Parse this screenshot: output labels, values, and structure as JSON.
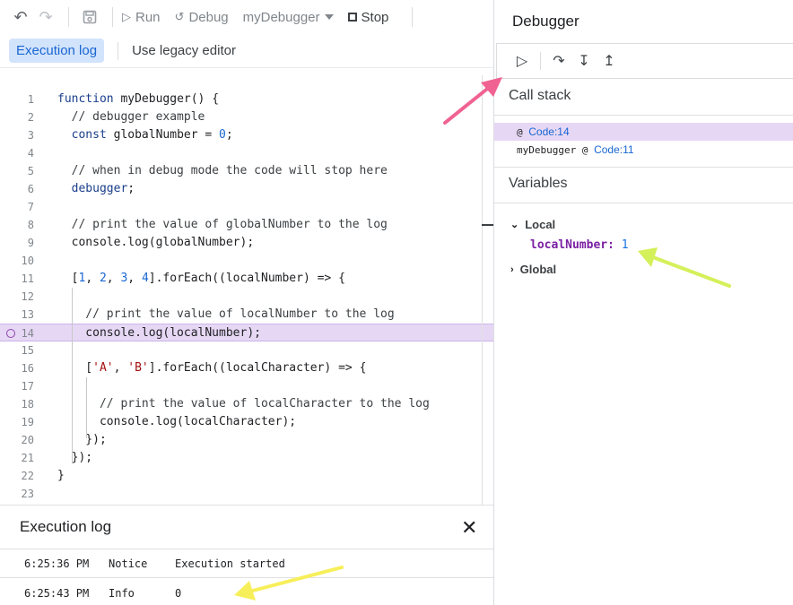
{
  "toolbar": {
    "undo_icon": "undo-icon",
    "redo_icon": "redo-icon",
    "save_icon": "save-icon",
    "run_label": "Run",
    "debug_label": "Debug",
    "function_select": "myDebugger",
    "stop_label": "Stop"
  },
  "subbar": {
    "execution_log": "Execution log",
    "legacy_editor": "Use legacy editor"
  },
  "editor": {
    "current_line": 14,
    "lines": [
      "function myDebugger() {",
      "  // debugger example",
      "  const globalNumber = 0;",
      "",
      "  // when in debug mode the code will stop here",
      "  debugger;",
      "",
      "  // print the value of globalNumber to the log",
      "  console.log(globalNumber);",
      "",
      "  [1, 2, 3, 4].forEach((localNumber) => {",
      "",
      "    // print the value of localNumber to the log",
      "    console.log(localNumber);",
      "",
      "    ['A', 'B'].forEach((localCharacter) => {",
      "",
      "      // print the value of localCharacter to the log",
      "      console.log(localCharacter);",
      "    });",
      "  });",
      "}",
      ""
    ]
  },
  "log": {
    "title": "Execution log",
    "rows": [
      {
        "time": "6:25:36 PM",
        "severity": "Notice",
        "message": "Execution started"
      },
      {
        "time": "6:25:43 PM",
        "severity": "Info",
        "message": "0"
      }
    ]
  },
  "debugger": {
    "title": "Debugger",
    "call_stack_title": "Call stack",
    "frames": [
      {
        "prefix": "@ ",
        "link": "Code:14"
      },
      {
        "prefix": "myDebugger @ ",
        "link": "Code:11"
      }
    ],
    "variables_title": "Variables",
    "local_label": "Local",
    "global_label": "Global",
    "variable": {
      "name": "localNumber:",
      "value": "1"
    }
  },
  "colors": {
    "highlight": "#e6d8f5",
    "link": "#1967d2",
    "arrow_pink": "#f06292",
    "arrow_green": "#d4f05a",
    "arrow_yellow": "#f7ef5a"
  }
}
